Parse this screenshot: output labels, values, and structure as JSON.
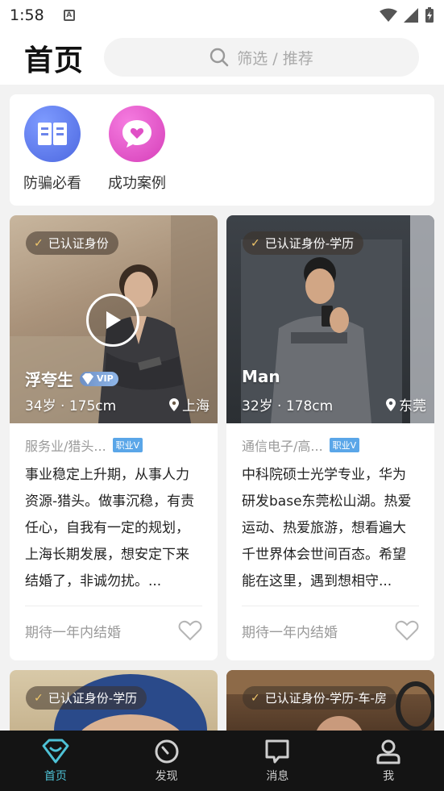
{
  "status_bar": {
    "time": "1:58",
    "app_icon": "A"
  },
  "header": {
    "title": "首页",
    "search_placeholder": "筛选 / 推荐"
  },
  "quick_links": [
    {
      "label": "防骗必看",
      "icon": "book-icon",
      "color": "#5b78e6"
    },
    {
      "label": "成功案例",
      "icon": "heart-chat-icon",
      "color": "#e04fc6"
    }
  ],
  "profiles": [
    {
      "verify": "已认证身份",
      "name": "浮夸生",
      "vip": "VIP",
      "has_video": true,
      "age_height": "34岁 · 175cm",
      "city": "上海",
      "job": "服务业/猎头...",
      "job_badge": "职业V",
      "bio": "事业稳定上升期，从事人力资源-猎头。做事沉稳，有责任心，自我有一定的规划，上海长期发展，想安定下来结婚了，非诚勿扰。...",
      "intent": "期待一年内结婚"
    },
    {
      "verify": "已认证身份-学历",
      "name": "Man",
      "vip": "",
      "has_video": false,
      "age_height": "32岁 · 178cm",
      "city": "东莞",
      "job": "通信电子/高...",
      "job_badge": "职业V",
      "bio": "中科院硕士光学专业，华为研发base东莞松山湖。热爱运动、热爱旅游，想看遍大千世界体会世间百态。希望能在这里，遇到想相守...",
      "intent": "期待一年内结婚"
    },
    {
      "verify": "已认证身份-学历"
    },
    {
      "verify": "已认证身份-学历-车-房"
    }
  ],
  "bottom_nav": [
    {
      "label": "首页",
      "icon": "diamond-icon",
      "active": true
    },
    {
      "label": "发现",
      "icon": "compass-icon",
      "active": false
    },
    {
      "label": "消息",
      "icon": "message-icon",
      "active": false
    },
    {
      "label": "我",
      "icon": "person-icon",
      "active": false
    }
  ],
  "colors": {
    "accent": "#4ec2d6",
    "nav_bg": "#141414"
  }
}
